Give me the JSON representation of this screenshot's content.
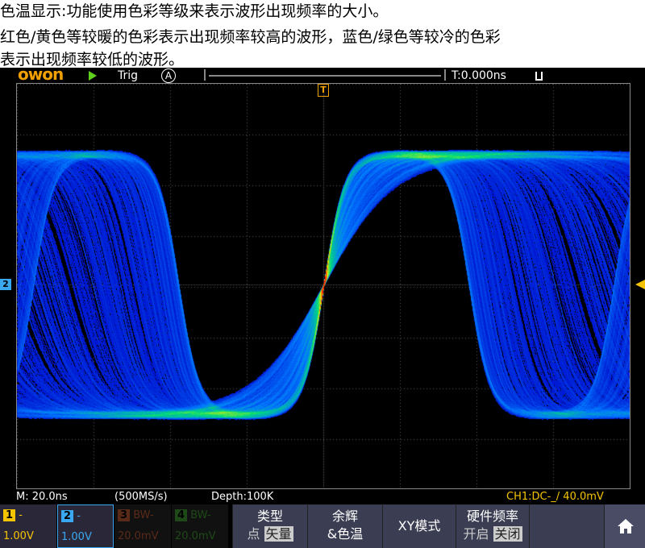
{
  "caption": {
    "line1": "色温显示:功能使用色彩等级来表示波形出现频率的大小。",
    "line2": "红色/黄色等较暖的色彩表示出现频率较高的波形，蓝色/绿色等较冷的色彩",
    "line3": "表示出现频率较低的波形。"
  },
  "header": {
    "logo": "owon",
    "trig_label": "Trig",
    "trig_mode": "A",
    "time_offset": "T:0.000ns",
    "lock_icon": "unlock-icon"
  },
  "markers": {
    "trigger": "T",
    "ch2": "2"
  },
  "status": {
    "timebase": "M: 20.0ns",
    "sample_rate": "(500MS/s)",
    "depth": "Depth:100K",
    "trigger_info": "CH1:DC-_/ 40.0mV"
  },
  "channels": [
    {
      "num": "1",
      "coupling": "-",
      "scale": "1.00V",
      "color": "#f5c400"
    },
    {
      "num": "2",
      "coupling": "-",
      "scale": "1.00V",
      "color": "#3aa8f0"
    },
    {
      "num": "3",
      "coupling": "BW-",
      "scale": "20.0mV",
      "color": "#5a2a18"
    },
    {
      "num": "4",
      "coupling": "BW-",
      "scale": "20.0mV",
      "color": "#1e4a18"
    }
  ],
  "menu": {
    "type_title": "类型",
    "type_opt1": "点",
    "type_opt2": "矢量",
    "persist_title": "余辉",
    "persist_sub": "&色温",
    "xy": "XY模式",
    "hw_title": "硬件频率",
    "hw_opt1": "开启",
    "hw_opt2": "关闭",
    "home_icon": "home-icon"
  }
}
